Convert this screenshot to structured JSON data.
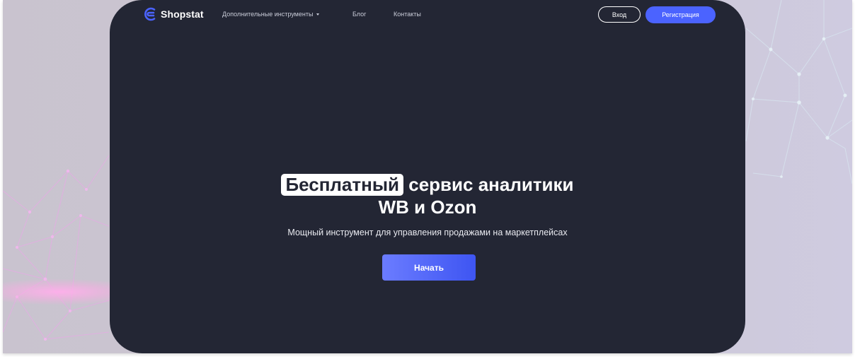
{
  "brand": {
    "name": "Shopstat",
    "accent": "#4b63ff",
    "logo_icon": "shopstat-logo-icon"
  },
  "nav": {
    "tools_label": "Дополнительные инструменты",
    "tools_icon": "caret-down-icon",
    "blog_label": "Блог",
    "contacts_label": "Контакты"
  },
  "auth": {
    "login_label": "Вход",
    "register_label": "Регистрация"
  },
  "hero": {
    "title_highlight": "Бесплатный",
    "title_rest": "сервис аналитики",
    "title_line2": "WB и Ozon",
    "subtitle": "Мощный инструмент для управления продажами на маркетплейсах",
    "cta_label": "Начать"
  },
  "colors": {
    "hero_bg": "#232634",
    "frame_bg": "#cbc7d1",
    "button_primary": "#4b63ff"
  }
}
